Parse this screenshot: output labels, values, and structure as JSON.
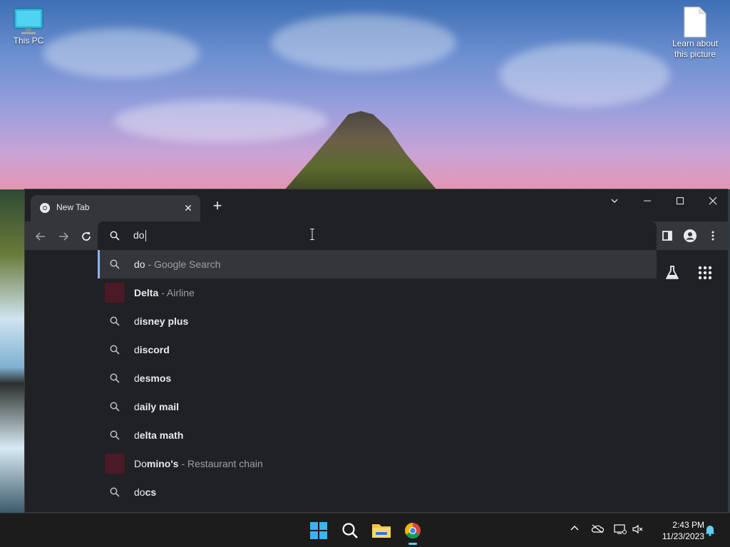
{
  "desktop": {
    "icons": [
      {
        "label": "This PC"
      },
      {
        "label": "Learn about this picture"
      }
    ]
  },
  "browser": {
    "tab": {
      "title": "New Tab"
    },
    "omnibox": {
      "value": "do"
    },
    "suggestions": [
      {
        "type": "search",
        "typed": "do",
        "rest": "",
        "sub": "- Google Search"
      },
      {
        "type": "entity",
        "typed": "",
        "rest": "Delta",
        "sub": "- Airline"
      },
      {
        "type": "search",
        "typed": "d",
        "rest": "isney plus",
        "sub": ""
      },
      {
        "type": "search",
        "typed": "d",
        "rest": "iscord",
        "sub": ""
      },
      {
        "type": "search",
        "typed": "d",
        "rest": "esmos",
        "sub": ""
      },
      {
        "type": "search",
        "typed": "d",
        "rest": "aily mail",
        "sub": ""
      },
      {
        "type": "search",
        "typed": "d",
        "rest": "elta math",
        "sub": ""
      },
      {
        "type": "entity",
        "typed": "Do",
        "rest": "mino's",
        "sub": "- Restaurant chain"
      },
      {
        "type": "search",
        "typed": "do",
        "rest": "cs",
        "sub": ""
      }
    ]
  },
  "taskbar": {
    "apps": [
      "start-icon",
      "search-icon",
      "file-explorer-icon",
      "chrome-icon"
    ],
    "clock": {
      "time": "2:43 PM",
      "date": "11/23/2023"
    }
  },
  "colors": {
    "accent": "#8ab4f8",
    "tile": "#4a1a26",
    "taskbar_indicator": "#60cdff"
  }
}
